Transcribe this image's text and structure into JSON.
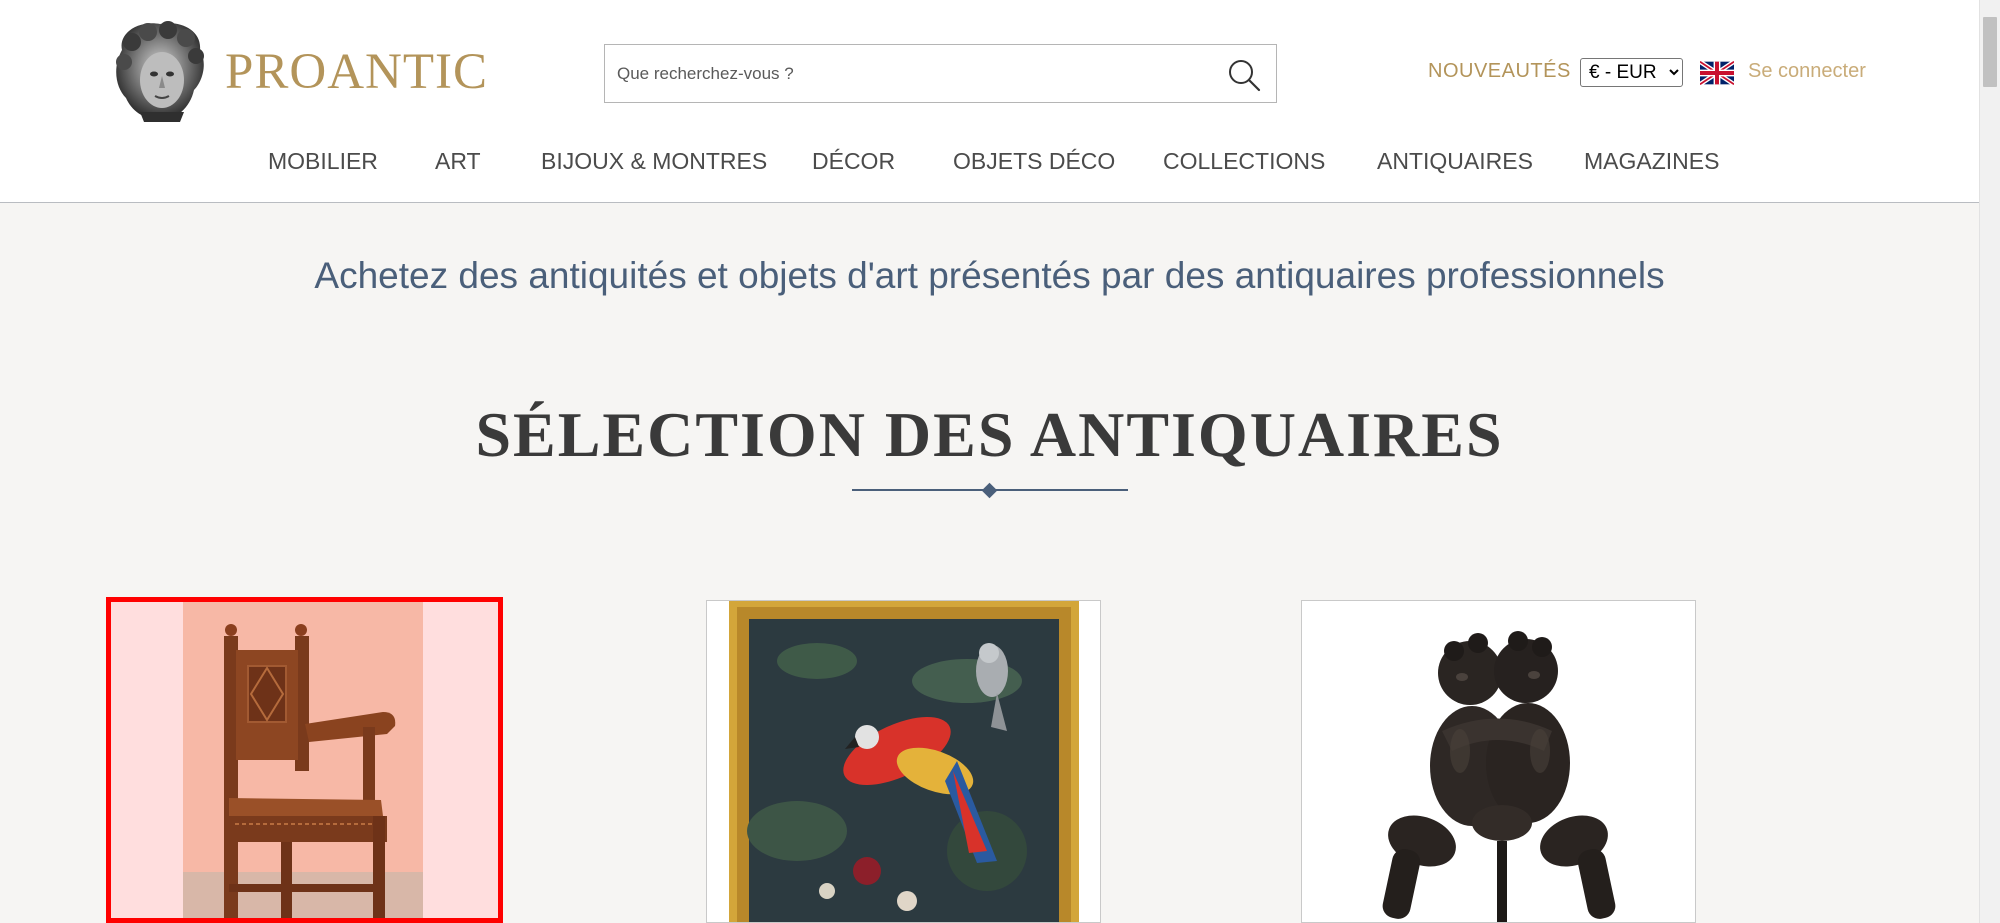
{
  "header": {
    "logo_text": "PROANTIC",
    "search": {
      "placeholder": "Que recherchez-vous ?"
    },
    "newness_label": "NOUVEAUTÉS",
    "currency_selected": "€ - EUR",
    "language_flag": "uk-flag-icon",
    "login_label": "Se connecter"
  },
  "nav": {
    "items": [
      {
        "label": "MOBILIER"
      },
      {
        "label": "ART"
      },
      {
        "label": "BIJOUX & MONTRES"
      },
      {
        "label": "DÉCOR"
      },
      {
        "label": "OBJETS DÉCO"
      },
      {
        "label": "COLLECTIONS"
      },
      {
        "label": "ANTIQUAIRES"
      },
      {
        "label": "MAGAZINES"
      }
    ]
  },
  "main": {
    "tagline": "Achetez des antiquités et objets d'art présentés par des antiquaires professionnels",
    "section_title": "SÉLECTION DES ANTIQUAIRES"
  },
  "colors": {
    "brand_gold": "#b3945a",
    "nav_text": "#4b4b4b",
    "tagline_blue": "#4a5f7a",
    "selection_outline": "#ff0000"
  }
}
